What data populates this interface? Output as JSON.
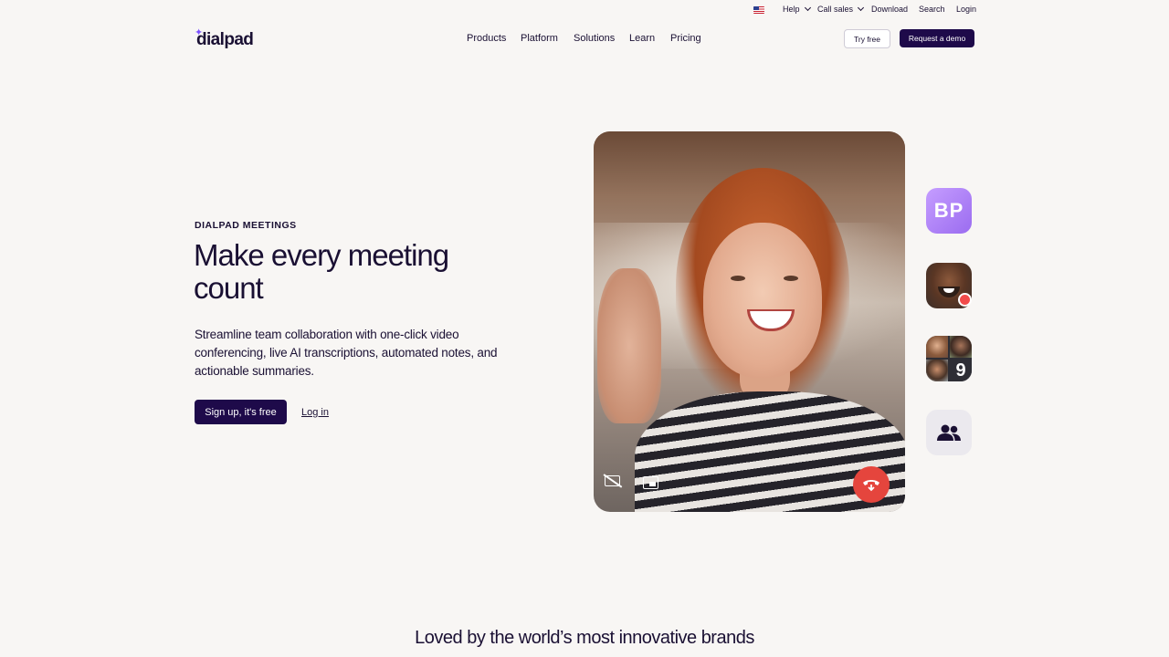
{
  "utility_bar": {
    "flag_icon": "us-flag-icon",
    "help": "Help",
    "call_sales": "Call sales",
    "download": "Download",
    "search": "Search",
    "login": "Login"
  },
  "nav": {
    "logo": "dialpad",
    "links": [
      "Products",
      "Platform",
      "Solutions",
      "Learn",
      "Pricing"
    ],
    "try_free": "Try free",
    "request_demo": "Request a demo"
  },
  "hero": {
    "eyebrow": "DIALPAD MEETINGS",
    "headline": "Make every meeting count",
    "description": "Streamline team collaboration with one-click video conferencing, live AI transcriptions, automated notes, and actionable summaries.",
    "signup": "Sign up, it's free",
    "login": "Log in"
  },
  "video_call": {
    "controls": [
      "camera-off-icon",
      "picture-in-picture-icon",
      "hang-up-icon"
    ],
    "participant_initials": "BP",
    "group_count": "9",
    "people_icon": "people-icon"
  },
  "tagline": "Loved by the world’s most innovative brands",
  "colors": {
    "background": "#f8f6f4",
    "brand_dark": "#1e0a4a",
    "accent_purple": "#7c52ff",
    "hangup_red": "#e5453d"
  }
}
